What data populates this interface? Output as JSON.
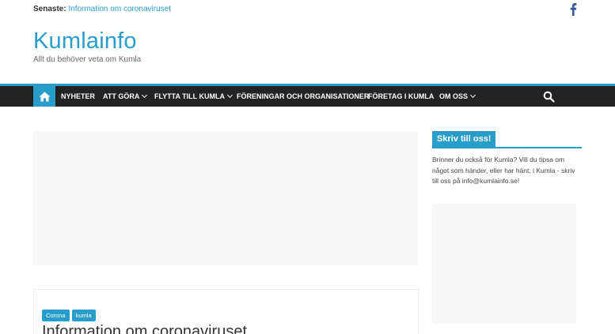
{
  "topbar": {
    "latest_label": "Senaste:",
    "latest_link": "Information om coronaviruset",
    "social_icon": "facebook-icon"
  },
  "header": {
    "site_title": "Kumlainfo",
    "site_description": "Allt du behöver veta om Kumla"
  },
  "nav": {
    "home_icon": "home-icon",
    "items": [
      {
        "label": "NYHETER",
        "has_dropdown": false
      },
      {
        "label": "ATT GÖRA",
        "has_dropdown": true
      },
      {
        "label": "FLYTTA TILL KUMLA",
        "has_dropdown": true
      },
      {
        "label": "FÖRENINGAR OCH ORGANISATIONER",
        "has_dropdown": false
      },
      {
        "label": "FÖRETAG I KUMLA",
        "has_dropdown": false
      },
      {
        "label": "OM OSS",
        "has_dropdown": true
      }
    ],
    "search_icon": "search-icon"
  },
  "post": {
    "tags": [
      "Corona",
      "kumla"
    ],
    "title": "Information om coronaviruset"
  },
  "sidebar": {
    "widget_title": "Skriv till oss!",
    "widget_text": "Brinner du också för Kumla? Vill du tipsa om något som händer, eller har hänt, i Kumla - skriv till oss på info@kumlainfo.se!"
  },
  "colors": {
    "accent": "#289dcc",
    "nav_background": "#232323",
    "ad_placeholder": "#f7f7f7"
  }
}
